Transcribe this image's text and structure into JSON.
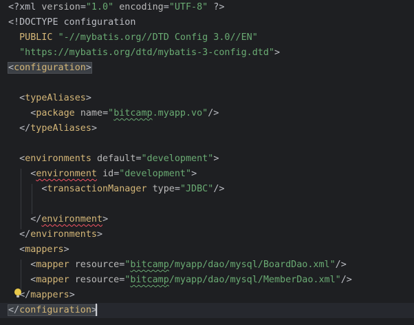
{
  "file": {
    "lines": [
      "<?xml version=\"1.0\" encoding=\"UTF-8\" ?>",
      "<!DOCTYPE configuration",
      "  PUBLIC \"-//mybatis.org//DTD Config 3.0//EN\"",
      "  \"https://mybatis.org/dtd/mybatis-3-config.dtd\">",
      "<configuration>",
      "",
      "  <typeAliases>",
      "    <package name=\"bitcamp.myapp.vo\"/>",
      "  </typeAliases>",
      "",
      "  <environments default=\"development\">",
      "    <environment id=\"development\">",
      "      <transactionManager type=\"JDBC\"/>",
      "",
      "    </environment>",
      "  </environments>",
      "  <mappers>",
      "    <mapper resource=\"bitcamp/myapp/dao/mysql/BoardDao.xml\"/>",
      "    <mapper resource=\"bitcamp/myapp/dao/mysql/MemberDao.xml\"/>",
      "  </mappers>",
      "</configuration>"
    ]
  },
  "tokens": {
    "xml_decl_open": "<?xml ",
    "version_attr": "version",
    "version_val": "\"1.0\"",
    "encoding_attr": "encoding",
    "encoding_val": "\"UTF-8\"",
    "xml_decl_close": " ?>",
    "doctype_open": "<!DOCTYPE",
    "doctype_name": " configuration",
    "public_kw": "  PUBLIC ",
    "public_id": "\"-//mybatis.org//DTD Config 3.0//EN\"",
    "system_id": "  \"https://mybatis.org/dtd/mybatis-3-config.dtd\"",
    "gt": ">",
    "lt": "<",
    "lt_slash": "</",
    "slash_gt": "/>",
    "eq": "=",
    "configuration": "configuration",
    "typeAliases": "typeAliases",
    "package": "package",
    "name_attr": "name",
    "package_val_q1": "\"",
    "package_val_bit": "bitcamp",
    "package_val_rest": ".myapp.vo\"",
    "environments": "environments",
    "default_attr": "default",
    "development_val": "\"development\"",
    "environment": "environment",
    "environment_sq": "environment",
    "id_attr": "id",
    "transactionManager": "transactionManager",
    "type_attr": "type",
    "jdbc_val": "\"JDBC\"",
    "mappers": "mappers",
    "mapper": "mapper",
    "resource_attr": "resource",
    "res_q": "\"",
    "res_bit": "bitcamp",
    "res_board_rest": "/myapp/dao/mysql/BoardDao.xml\"",
    "res_member_rest": "/myapp/dao/mysql/MemberDao.xml\""
  },
  "colors": {
    "background": "#1e1f22",
    "tag": "#d5b778",
    "attribute": "#bababa",
    "string": "#6aab73",
    "text": "#bcbec4",
    "error_squiggle": "#f75464",
    "current_line": "#26282e"
  },
  "caret": {
    "line": 21
  }
}
